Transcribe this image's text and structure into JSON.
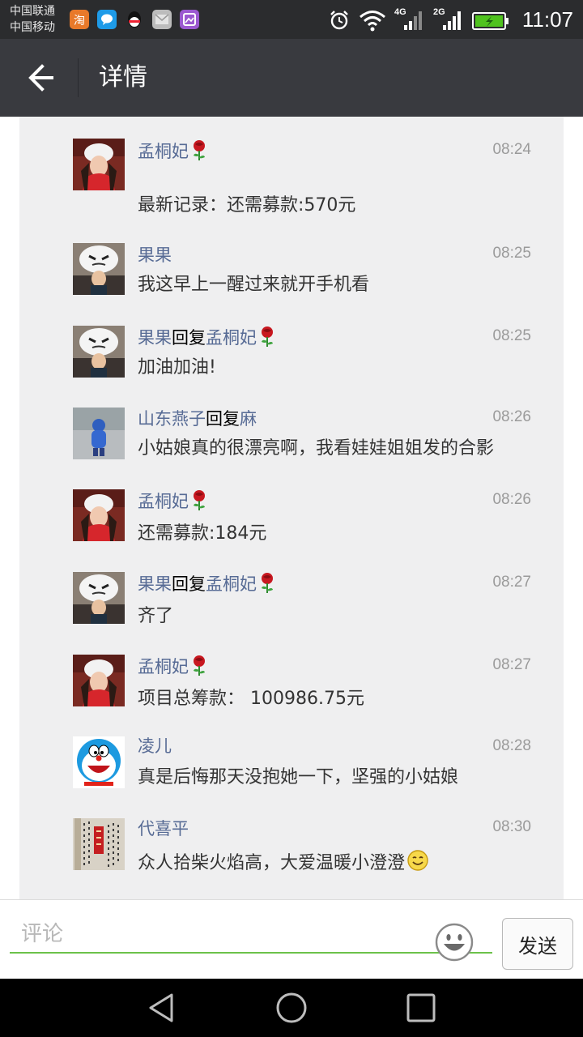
{
  "status_bar": {
    "carrier_1": "中国联通",
    "carrier_2": "中国移动",
    "net_1": "4G",
    "net_2": "2G",
    "time": "11:07",
    "notification_icons": [
      "taobao-icon",
      "chat-icon",
      "qq-icon",
      "mail-icon",
      "gallery-icon"
    ]
  },
  "header": {
    "title": "详情"
  },
  "comments": [
    {
      "name": "孟桐妃",
      "has_rose": true,
      "time": "08:24",
      "text": "最新记录：还需募款:570元",
      "avatar": "avatar-woman-red-scarf"
    },
    {
      "name": "果果",
      "has_rose": false,
      "time": "08:25",
      "text": "我这早上一醒过来就开手机看",
      "avatar": "avatar-child-mask"
    },
    {
      "name": "果果",
      "reply_word": "回复",
      "reply_to": "孟桐妃",
      "reply_rose": true,
      "time": "08:25",
      "text": "加油加油!",
      "avatar": "avatar-child-mask"
    },
    {
      "name": "山东燕子",
      "reply_word": "回复",
      "reply_to": "麻",
      "time": "08:26",
      "text": "小姑娘真的很漂亮啊，我看娃娃姐姐发的合影",
      "avatar": "avatar-child-blue"
    },
    {
      "name": "孟桐妃",
      "has_rose": true,
      "time": "08:26",
      "text": "还需募款:184元",
      "avatar": "avatar-woman-red-scarf"
    },
    {
      "name": "果果",
      "reply_word": "回复",
      "reply_to": "孟桐妃",
      "reply_rose": true,
      "time": "08:27",
      "text": "齐了",
      "avatar": "avatar-child-mask"
    },
    {
      "name": "孟桐妃",
      "has_rose": true,
      "time": "08:27",
      "text": "项目总筹款：  100986.75元",
      "avatar": "avatar-woman-red-scarf"
    },
    {
      "name": "凌儿",
      "time": "08:28",
      "text": "真是后悔那天没抱她一下，坚强的小姑娘",
      "avatar": "avatar-doraemon"
    },
    {
      "name": "代喜平",
      "time": "08:30",
      "text": "众人拾柴火焰高，大爱温暖小澄澄",
      "text_emoji": "smile-emoji",
      "avatar": "avatar-calligraphy"
    }
  ],
  "input_bar": {
    "placeholder": "评论",
    "send_label": "发送"
  },
  "colors": {
    "title_bar": "#393a3f",
    "status_bar": "#2b2c2e",
    "name_link": "#576b95",
    "input_underline": "#6cc24a",
    "panel_bg": "#efeff0"
  }
}
